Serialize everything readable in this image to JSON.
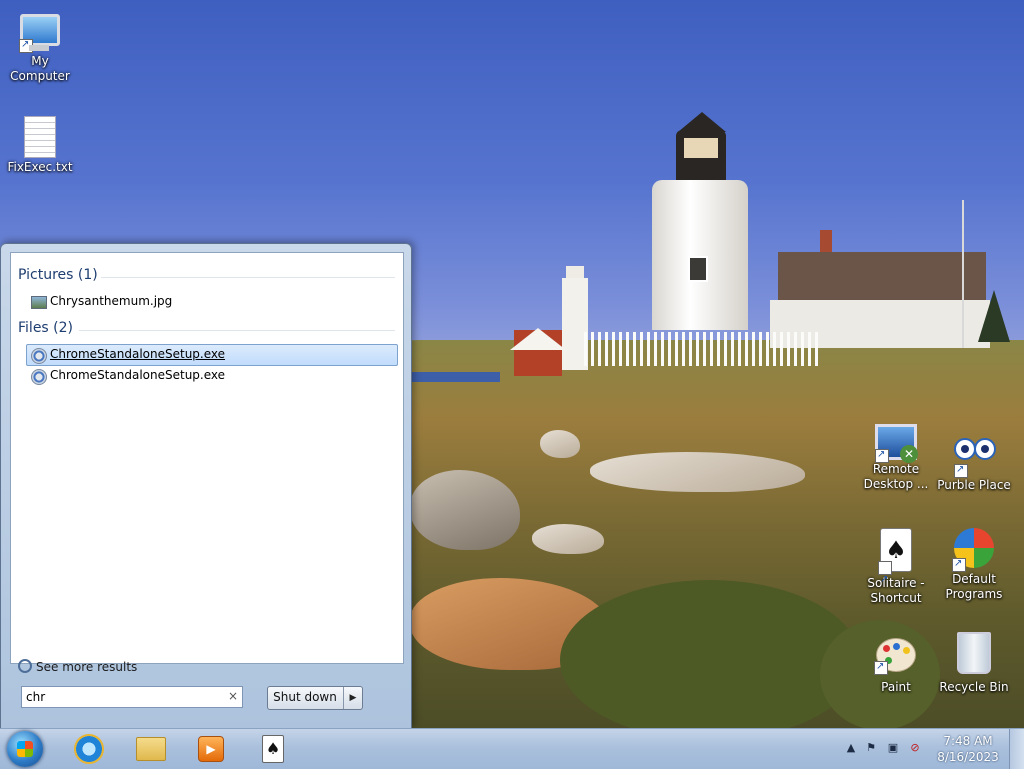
{
  "desktop": {
    "icons": [
      {
        "label": "My Computer",
        "icon": "computer-icon"
      },
      {
        "label": "FixExec.txt",
        "icon": "text-file-icon"
      },
      {
        "label": "Remote Desktop ...",
        "icon": "remote-desktop-icon"
      },
      {
        "label": "Purble Place",
        "icon": "purble-place-icon"
      },
      {
        "label": "Solitaire - Shortcut",
        "icon": "solitaire-icon"
      },
      {
        "label": "Default Programs",
        "icon": "default-programs-icon"
      },
      {
        "label": "Paint",
        "icon": "paint-icon"
      },
      {
        "label": "Recycle Bin",
        "icon": "recycle-bin-icon"
      }
    ]
  },
  "start_menu": {
    "groups": [
      {
        "header": "Pictures (1)",
        "items": [
          {
            "label": "Chrysanthemum.jpg",
            "icon": "picture-file-icon"
          }
        ]
      },
      {
        "header": "Files (2)",
        "items": [
          {
            "label": "ChromeStandaloneSetup.exe",
            "icon": "setup-exe-icon",
            "selected": true
          },
          {
            "label": "ChromeStandaloneSetup.exe",
            "icon": "setup-exe-icon"
          }
        ]
      }
    ],
    "see_more": "See more results",
    "search": {
      "value": "chr",
      "clear_glyph": "×"
    },
    "shutdown_label": "Shut down",
    "shutdown_arrow": "▶"
  },
  "taskbar": {
    "pinned": [
      "internet-explorer-icon",
      "windows-explorer-icon",
      "media-player-icon",
      "solitaire-icon"
    ],
    "tray": [
      "show-hidden-icons-icon",
      "action-center-flag-icon",
      "network-icon",
      "volume-muted-icon"
    ],
    "clock": {
      "time": "7:48 AM",
      "date": "8/16/2023"
    }
  },
  "colors": {
    "accent": "#2d7bc7",
    "selection": "#c1dcfc",
    "group_header": "#1e3d70"
  }
}
